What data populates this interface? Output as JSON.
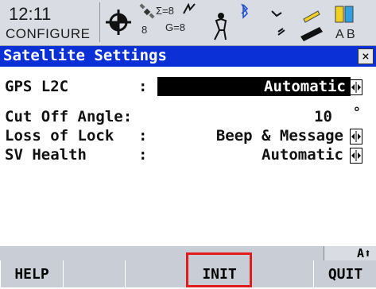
{
  "status": {
    "time": "12:11",
    "mode": "CONFIGURE",
    "sat_sigma": "Σ=8",
    "sat_g": "G=8",
    "sat_count": "8"
  },
  "title": "Satellite Settings",
  "rows": [
    {
      "label": "GPS L2C",
      "colon": ":",
      "value": "Automatic"
    },
    {
      "label": "Cut Off Angle:",
      "value": "10",
      "unit": "°"
    },
    {
      "label": "Loss of Lock",
      "colon": ":",
      "value": "Beep & Message"
    },
    {
      "label": "SV Health",
      "colon": ":",
      "value": "Automatic"
    }
  ],
  "shift_indicator": "A⬆",
  "fkeys": {
    "f1": "HELP",
    "f4": "INIT",
    "f6": "QUIT"
  },
  "colors": {
    "title_bar": "#0a30d6",
    "highlight": "#e21c1c"
  }
}
